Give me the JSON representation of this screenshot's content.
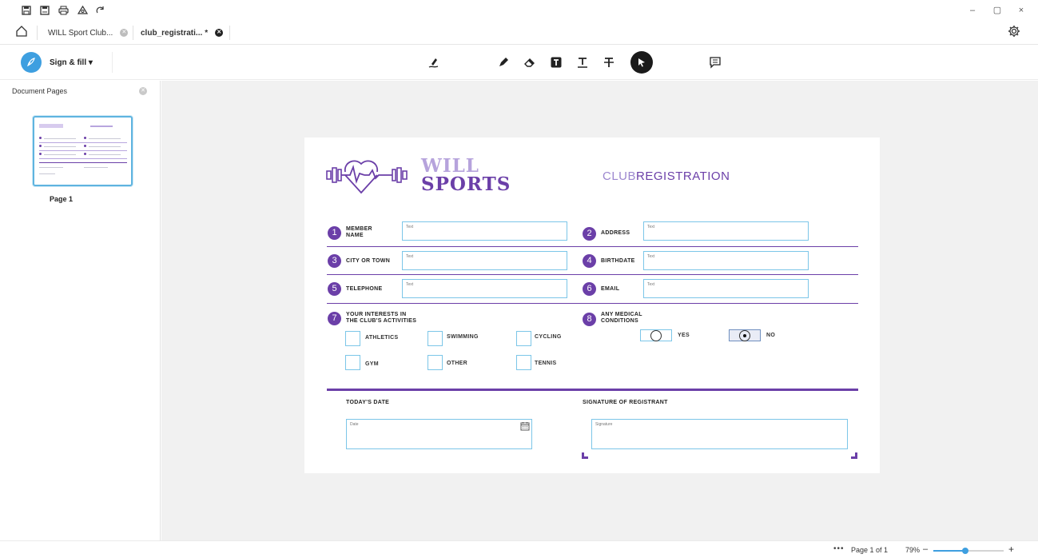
{
  "quick_access": {
    "icons": [
      "save-icon",
      "save-as-icon",
      "print-icon",
      "share-icon",
      "redo-icon"
    ]
  },
  "window_controls": {
    "minimize": "–",
    "restore": "▢",
    "close": "×"
  },
  "tabs": [
    {
      "label": "WILL Sport Club...",
      "active": false,
      "modified": false
    },
    {
      "label": "club_registrati...",
      "active": true,
      "modified": true,
      "modified_mark": "*"
    }
  ],
  "toolbar": {
    "mode_label": "Sign & fill ▾",
    "tools": [
      "sign-icon",
      "highlight-pen-icon",
      "eraser-icon",
      "text-box-icon",
      "underline-icon",
      "strikethrough-icon",
      "select-cursor-icon",
      "comment-icon"
    ],
    "active_tool": "select-cursor-icon"
  },
  "sidebar": {
    "title": "Document Pages",
    "pages": [
      {
        "label": "Page 1",
        "selected": true
      }
    ]
  },
  "document": {
    "brand_line1": "WILL",
    "brand_line2": "SPORTS",
    "title_part1": "CLUB",
    "title_part2": "REGISTRATION",
    "fields": [
      {
        "num": "1",
        "label_line1": "MEMBER",
        "label_line2": "NAME",
        "placeholder": "Text"
      },
      {
        "num": "2",
        "label_line1": "ADDRESS",
        "label_line2": "",
        "placeholder": "Text"
      },
      {
        "num": "3",
        "label_line1": "CITY OR TOWN",
        "label_line2": "",
        "placeholder": "Text"
      },
      {
        "num": "4",
        "label_line1": "BIRTHDATE",
        "label_line2": "",
        "placeholder": "Text"
      },
      {
        "num": "5",
        "label_line1": "TELEPHONE",
        "label_line2": "",
        "placeholder": "Text"
      },
      {
        "num": "6",
        "label_line1": "EMAIL",
        "label_line2": "",
        "placeholder": "Text"
      }
    ],
    "interests": {
      "num": "7",
      "label_line1": "YOUR INTERESTS IN",
      "label_line2": "THE CLUB'S ACTIVITIES",
      "options": [
        {
          "label": "ATHLETICS",
          "checked": false
        },
        {
          "label": "SWIMMING",
          "checked": false
        },
        {
          "label": "CYCLING",
          "checked": false
        },
        {
          "label": "GYM",
          "checked": false
        },
        {
          "label": "OTHER",
          "checked": false
        },
        {
          "label": "TENNIS",
          "checked": false
        }
      ]
    },
    "medical": {
      "num": "8",
      "label_line1": "ANY MEDICAL",
      "label_line2": "CONDITIONS",
      "yes_label": "YES",
      "no_label": "NO",
      "selected": "NO"
    },
    "date": {
      "label": "TODAY'S DATE",
      "placeholder": "Date"
    },
    "signature": {
      "label": "SIGNATURE OF REGISTRANT",
      "placeholder": "Signature"
    }
  },
  "status": {
    "more": "•••",
    "page_indicator": "Page 1 of 1",
    "zoom_label": "79%",
    "zoom_minus": "–",
    "zoom_plus": "+",
    "zoom_level_fraction": 0.45
  },
  "colors": {
    "brand_purple": "#6b3fa8",
    "brand_lavender": "#b6a3dc",
    "field_border": "#7cc6e8",
    "accent_blue": "#3e9fe0"
  }
}
